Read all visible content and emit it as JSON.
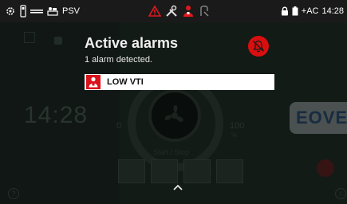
{
  "status_bar": {
    "mode_label": "PSV",
    "power_label": "AC",
    "time": "14:28"
  },
  "background": {
    "clock": "14:28",
    "min_label": "0",
    "max_label": "100",
    "unit_label": "%",
    "start_stop": "Start / Stop",
    "brand": "EOVE"
  },
  "alarm_panel": {
    "title": "Active alarms",
    "subtitle": "1 alarm detected.",
    "alarms": [
      {
        "label": "LOW VTI",
        "color": "#d9121b"
      }
    ]
  },
  "colors": {
    "alarm_red": "#d90f0f",
    "status_bar_bg": "#1a1a1a"
  }
}
